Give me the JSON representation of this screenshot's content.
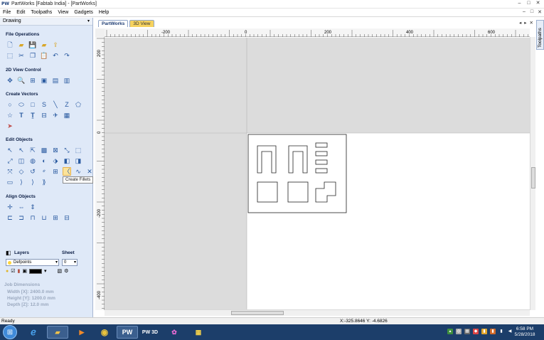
{
  "window": {
    "app_icon": "PW",
    "title": "PartWorks [Fabtab India] - [PartWorks]",
    "controls": [
      "–",
      "□",
      "✕"
    ]
  },
  "menu": {
    "items": [
      "File",
      "Edit",
      "Toolpaths",
      "View",
      "Gadgets",
      "Help"
    ],
    "mdi_controls": [
      "–",
      "□",
      "✕"
    ]
  },
  "panel": {
    "title": "Drawing",
    "pin": "📌",
    "sections": {
      "file_ops": "File Operations",
      "view_ctrl": "2D View Control",
      "create_vectors": "Create Vectors",
      "edit_objects": "Edit Objects",
      "align_objects": "Align Objects"
    },
    "tooltip": "Create Fillets",
    "layers": {
      "title": "Layers",
      "sheet_title": "Sheet",
      "selected_layer": "Defpoints",
      "selected_sheet": "0"
    },
    "job": {
      "title": "Job Dimensions",
      "width": "Width  [X]: 2400.0 mm",
      "height": "Height [Y]: 1200.0 mm",
      "depth": "Depth  [Z]: 12.0 mm"
    }
  },
  "tabs": {
    "partworks": "PartWorks",
    "view3d": "3D View",
    "controls": [
      "◂",
      "▸",
      "✕"
    ]
  },
  "right_tab": "Toolpaths",
  "ruler": {
    "top_labels": [
      "-200",
      "0",
      "200",
      "400",
      "600"
    ],
    "left_labels": [
      "200",
      "0",
      "-200",
      "-400"
    ]
  },
  "status": {
    "left": "Ready",
    "coords": "X:-325.8646 Y: -4.6826"
  },
  "taskbar": {
    "pw_label": "PW",
    "pw3d_label": "PW 3D",
    "time": "6:58 PM",
    "date": "5/28/2018"
  },
  "colors": {
    "panel_bg": "#dfe9f8",
    "canvas_grey": "#dcdcdc",
    "taskbar": "#1c3e6a",
    "active_tool": "#fbe39a",
    "inactive_tab": "#f6d25e"
  }
}
